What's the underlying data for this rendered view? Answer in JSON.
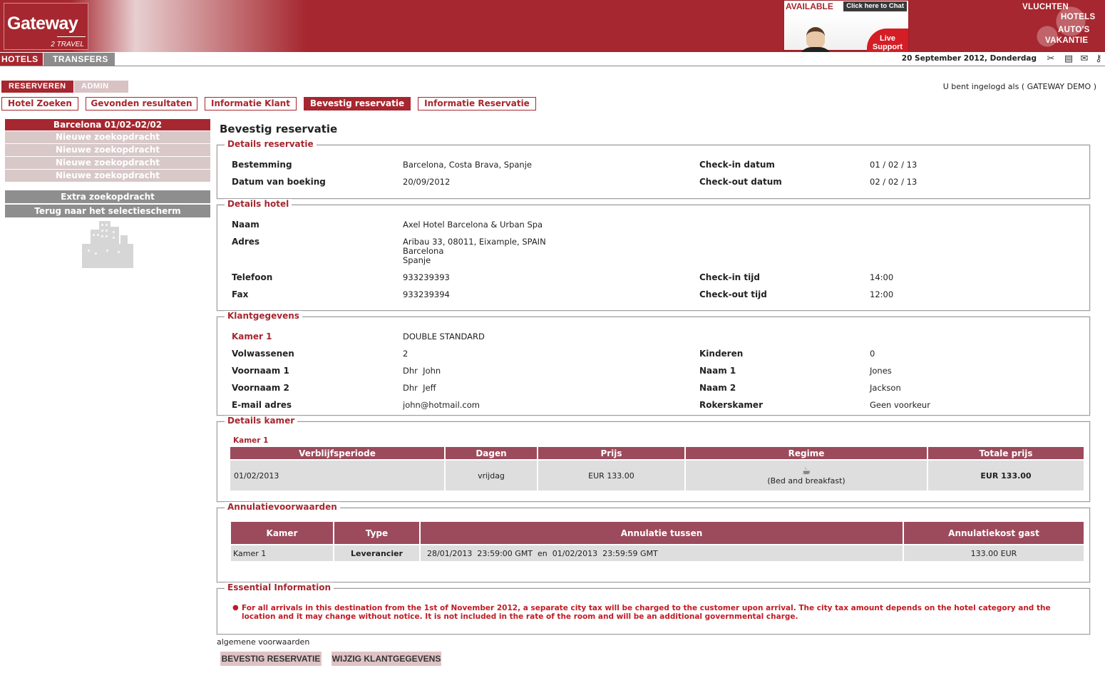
{
  "header": {
    "logo_text": "Gateway",
    "logo_sub": "2 TRAVEL",
    "chat": {
      "available": "AVAILABLE",
      "click": "Click here to Chat",
      "support_line1": "Live",
      "support_line2": "Support"
    },
    "nav_links": [
      "VLUCHTEN",
      "HOTELS",
      "AUTO'S",
      "VAKANTIE"
    ]
  },
  "topbar": {
    "tabs": [
      "HOTELS",
      "TRANSFERS"
    ],
    "date": "20 September 2012, Donderdag",
    "icons": [
      "tools-icon",
      "notepad-icon",
      "mail-icon",
      "key-icon"
    ]
  },
  "subtabs": {
    "reserveren": "RESERVEREN",
    "admin": "ADMIN"
  },
  "login_text": "U bent ingelogd als ( GATEWAY DEMO )",
  "steps": [
    "Hotel Zoeken",
    "Gevonden resultaten",
    "Informatie Klant",
    "Bevestig reservatie",
    "Informatie Reservatie"
  ],
  "sidebar": {
    "current_search": "Barcelona 01/02-02/02",
    "new_searches": [
      "Nieuwe zoekopdracht",
      "Nieuwe zoekopdracht",
      "Nieuwe zoekopdracht",
      "Nieuwe zoekopdracht"
    ],
    "extra": "Extra zoekopdracht",
    "back": "Terug naar het selectiescherm"
  },
  "page_title": "Bevestig reservatie",
  "reservation": {
    "legend": "Details reservatie",
    "bestemming_label": "Bestemming",
    "bestemming": "Barcelona, Costa Brava, Spanje",
    "datum_label": "Datum van boeking",
    "datum": "20/09/2012",
    "checkin_label": "Check-in datum",
    "checkin": "01 / 02 / 13",
    "checkout_label": "Check-out datum",
    "checkout": "02 / 02 / 13"
  },
  "hotel": {
    "legend": "Details hotel",
    "naam_label": "Naam",
    "naam": "Axel Hotel Barcelona & Urban Spa",
    "adres_label": "Adres",
    "adres_line1": "Aribau 33, 08011, Eixample, SPAIN",
    "adres_line2": "Barcelona",
    "adres_line3": "Spanje",
    "telefoon_label": "Telefoon",
    "telefoon": "933239393",
    "fax_label": "Fax",
    "fax": "933239394",
    "checkin_tijd_label": "Check-in tijd",
    "checkin_tijd": "14:00",
    "checkout_tijd_label": "Check-out tijd",
    "checkout_tijd": "12:00"
  },
  "klant": {
    "legend": "Klantgegevens",
    "kamer_label": "Kamer 1",
    "kamer": "DOUBLE STANDARD",
    "volwassenen_label": "Volwassenen",
    "volwassenen": "2",
    "kinderen_label": "Kinderen",
    "kinderen": "0",
    "voornaam1_label": "Voornaam 1",
    "voornaam1": "Dhr  John",
    "naam1_label": "Naam 1",
    "naam1": "Jones",
    "voornaam2_label": "Voornaam 2",
    "voornaam2": "Dhr  Jeff",
    "naam2_label": "Naam 2",
    "naam2": "Jackson",
    "email_label": "E-mail adres",
    "email": "john@hotmail.com",
    "roker_label": "Rokerskamer",
    "roker": "Geen voorkeur"
  },
  "kamer": {
    "legend": "Details kamer",
    "title": "Kamer 1",
    "headers": [
      "Verblijfsperiode",
      "Dagen",
      "Prijs",
      "Regime",
      "Totale prijs"
    ],
    "row": {
      "periode": "01/02/2013",
      "dag": "vrijdag",
      "prijs": "EUR 133.00",
      "regime": "(Bed and breakfast)",
      "totaal": "EUR 133.00"
    }
  },
  "annulatie": {
    "legend": "Annulatievoorwaarden",
    "headers": [
      "Kamer",
      "Type",
      "Annulatie tussen",
      "Annulatiekost gast"
    ],
    "row": {
      "kamer": "Kamer 1",
      "type": "Leverancier",
      "tussen": "28/01/2013  23:59:00 GMT  en  01/02/2013  23:59:59 GMT",
      "kost": "133.00 EUR"
    }
  },
  "essential": {
    "legend": "Essential Information",
    "text": "For all arrivals in this destination from the 1st of November 2012, a separate city tax will be charged to the customer upon arrival. The city tax amount depends on the hotel category and the location and it may change without notice. It is not included in the rate of the room and will be an additional governmental charge."
  },
  "terms": "algemene voorwaarden",
  "buttons": {
    "confirm": "BEVESTIG RESERVATIE",
    "edit": "WIJZIG KLANTGEGEVENS"
  }
}
